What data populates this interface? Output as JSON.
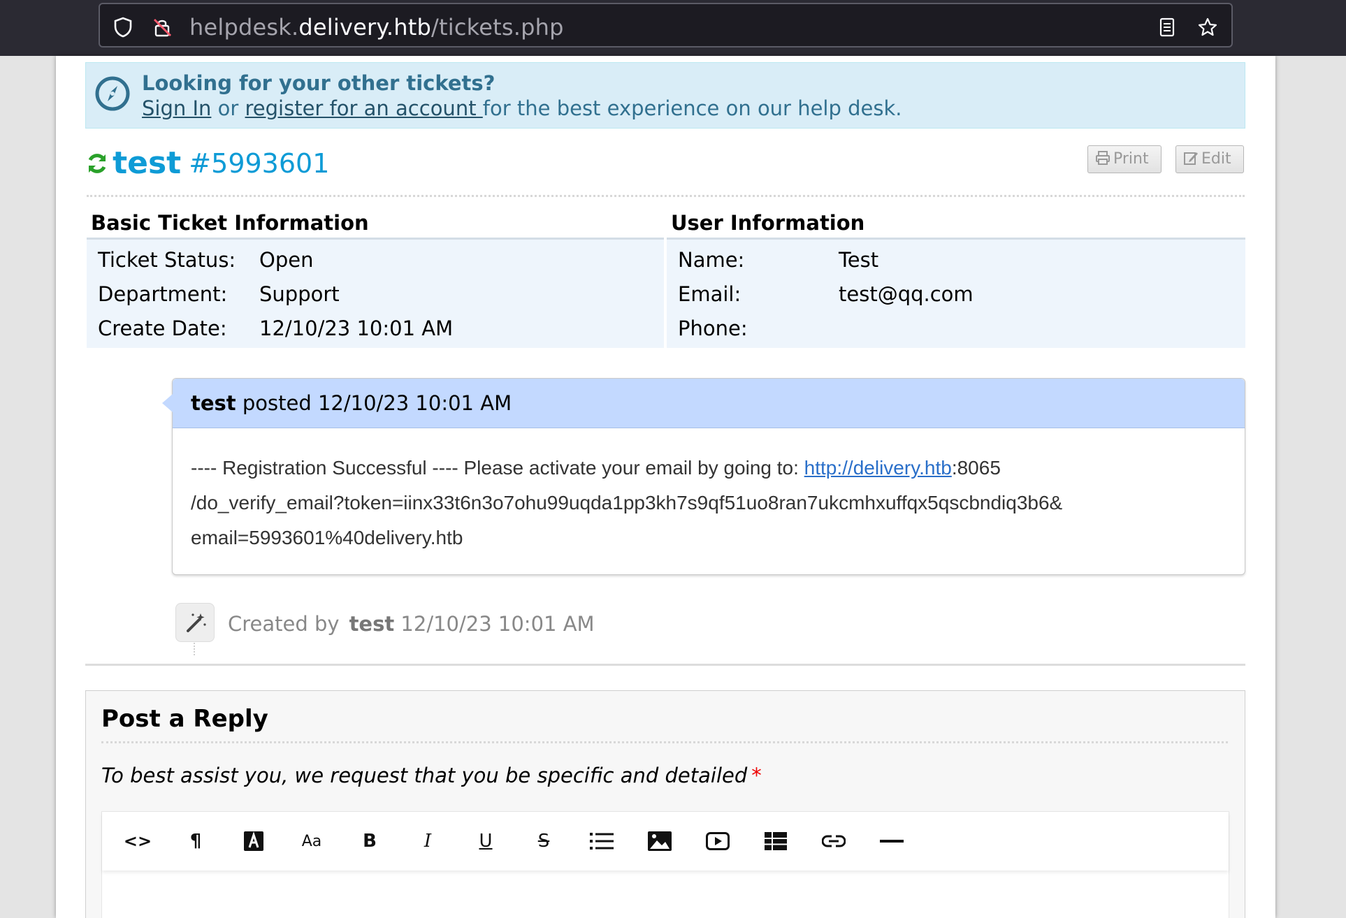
{
  "browser": {
    "url_prefix": "helpdesk.",
    "url_domain": "delivery.htb",
    "url_path": "/tickets.php"
  },
  "banner": {
    "title": "Looking for your other tickets?",
    "sign_in": "Sign In",
    "or": " or ",
    "register": "register for an account ",
    "rest": "for the best experience on our help desk."
  },
  "ticket": {
    "subject": "test",
    "number": "#5993601",
    "print_label": "Print",
    "edit_label": "Edit"
  },
  "basic_info": {
    "heading": "Basic Ticket Information",
    "rows": [
      {
        "label": "Ticket Status:",
        "value": "Open"
      },
      {
        "label": "Department:",
        "value": "Support"
      },
      {
        "label": "Create Date:",
        "value": "12/10/23 10:01 AM"
      }
    ]
  },
  "user_info": {
    "heading": "User Information",
    "rows": [
      {
        "label": "Name:",
        "value": "Test"
      },
      {
        "label": "Email:",
        "value": "test@qq.com"
      },
      {
        "label": "Phone:",
        "value": ""
      }
    ]
  },
  "thread": {
    "author": "test",
    "posted_text": " posted 12/10/23 10:01 AM",
    "body_line1_pre": "---- Registration Successful ---- Please activate your email by going to: ",
    "body_link": "http://delivery.htb",
    "body_line1_post": ":8065",
    "body_line2": "/do_verify_email?token=iinx33t6n3o7ohu99uqda1pp3kh7s9qf51uo8ran7ukcmhxuffqx5qscbndiq3b6&",
    "body_line3": "email=5993601%40delivery.htb"
  },
  "event": {
    "created_by": "Created by",
    "author": "test",
    "time": " 12/10/23 10:01 AM"
  },
  "reply": {
    "title": "Post a Reply",
    "hint": "To best assist you, we request that you be specific and detailed",
    "required_mark": "*",
    "toolbar": {
      "code": "<>",
      "paragraph": "¶",
      "font_size": "Aa",
      "bold": "B",
      "italic": "I",
      "underline": "U",
      "strike": "S"
    }
  }
}
